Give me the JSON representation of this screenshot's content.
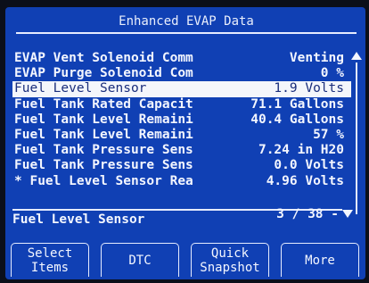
{
  "title": "Enhanced EVAP Data",
  "rows": [
    {
      "label": "EVAP Vent Solenoid Comm",
      "value": "Venting"
    },
    {
      "label": "EVAP Purge Solenoid Com",
      "value": "0 %"
    },
    {
      "label": "Fuel Level Sensor",
      "value": "1.9 Volts"
    },
    {
      "label": "Fuel Tank Rated Capacit",
      "value": "71.1 Gallons"
    },
    {
      "label": "Fuel Tank Level Remaini",
      "value": "40.4 Gallons"
    },
    {
      "label": "Fuel Tank Level Remaini",
      "value": "57 %"
    },
    {
      "label": "Fuel Tank Pressure Sens",
      "value": "7.24 in H20"
    },
    {
      "label": "Fuel Tank Pressure Sens",
      "value": "0.0 Volts"
    },
    {
      "label": "* Fuel Level Sensor Rea",
      "value": "4.96 Volts"
    }
  ],
  "selected_index": 2,
  "selected_name": "Fuel Level Sensor",
  "page_indicator": "3 / 38 -",
  "softkeys": {
    "select_items": {
      "line1": "Select",
      "line2": "Items"
    },
    "dtc": "DTC",
    "quick_snapshot": {
      "line1": "Quick",
      "line2": "Snapshot"
    },
    "more": "More"
  },
  "icons": {
    "scroll_up": "triangle-up-icon",
    "scroll_down": "triangle-down-icon"
  },
  "colors": {
    "background": "#1040b4",
    "text": "#f3f6ff",
    "highlight": "#f4f6fb"
  }
}
